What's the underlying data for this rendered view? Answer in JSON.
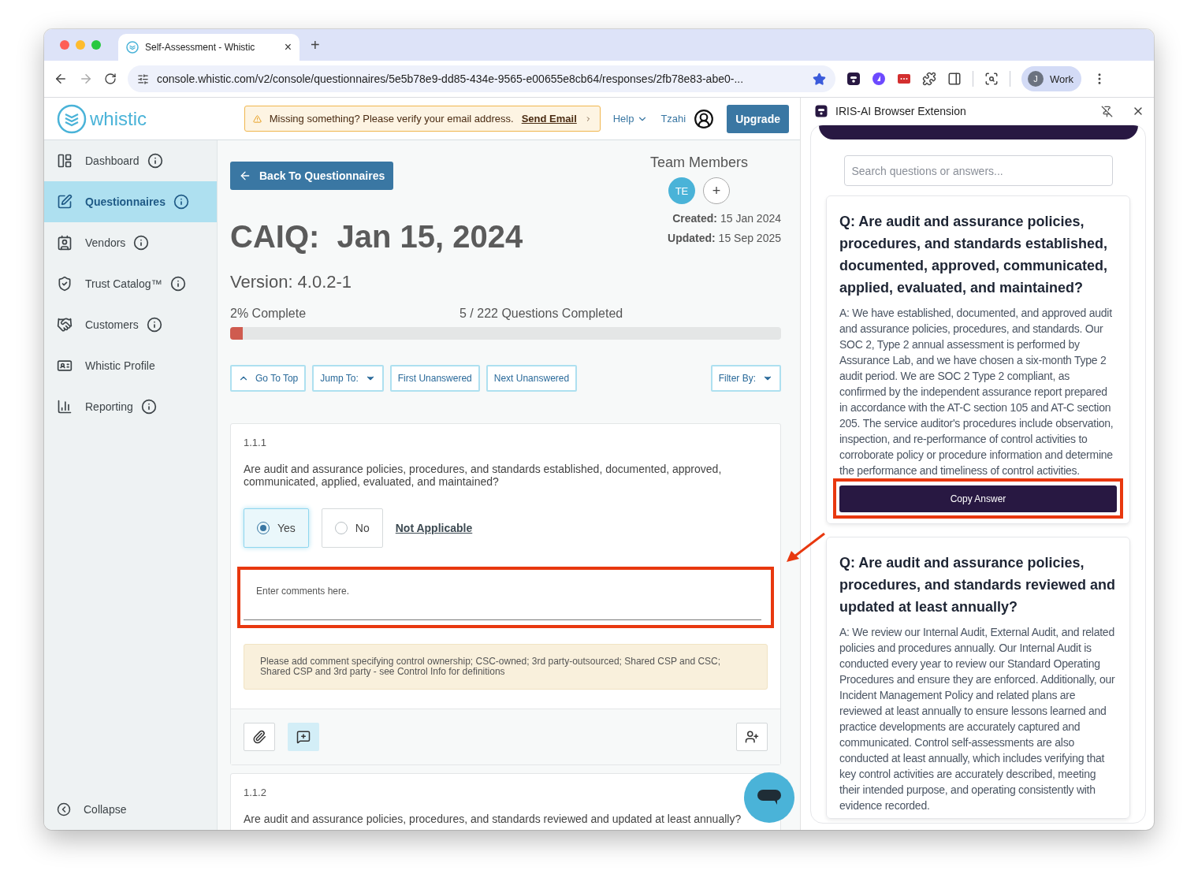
{
  "browser": {
    "tab": {
      "title": "Self-Assessment - Whistic",
      "close": "×"
    },
    "new_tab": "+",
    "url": "console.whistic.com/v2/console/questionnaires/5e5b78e9-dd85-434e-9565-e00655e8cb64/responses/2fb78e83-abe0-...",
    "profile": {
      "initial": "J",
      "name": "Work"
    }
  },
  "app": {
    "logo": "whistic",
    "banner": {
      "text": "Missing something? Please verify your email address.",
      "link": "Send Email"
    },
    "help": "Help",
    "user": "Tzahi",
    "upgrade": "Upgrade"
  },
  "sidebar": {
    "items": [
      {
        "label": "Dashboard",
        "info": true,
        "selected": false
      },
      {
        "label": "Questionnaires",
        "info": true,
        "selected": true
      },
      {
        "label": "Vendors",
        "info": true,
        "selected": false
      },
      {
        "label": "Trust Catalog™",
        "info": true,
        "selected": false
      },
      {
        "label": "Customers",
        "info": true,
        "selected": false
      },
      {
        "label": "Whistic Profile",
        "info": false,
        "selected": false
      },
      {
        "label": "Reporting",
        "info": true,
        "selected": false
      }
    ],
    "collapse": "Collapse"
  },
  "main": {
    "back": "Back To Questionnaires",
    "team": {
      "title": "Team Members",
      "members": [
        "TE"
      ],
      "add": "+"
    },
    "title": "CAIQ:  Jan 15, 2024",
    "created": {
      "label": "Created:",
      "value": "15 Jan 2024"
    },
    "updated": {
      "label": "Updated:",
      "value": "15 Sep 2025"
    },
    "version": "Version: 4.0.2-1",
    "progress": {
      "percent": "2% Complete",
      "count": "5 / 222 Questions Completed",
      "level": 0.023
    },
    "toolbar": [
      {
        "label": "Go To Top",
        "kind": "up"
      },
      {
        "label": "Jump To:",
        "kind": "dropdown"
      },
      {
        "label": "First Unanswered",
        "kind": "plain"
      },
      {
        "label": "Next Unanswered",
        "kind": "plain"
      }
    ],
    "filter": {
      "label": "Filter By:"
    },
    "questions": [
      {
        "number": "1.1.1",
        "text": "Are audit and assurance policies, procedures, and standards established, documented, approved, communicated, applied, evaluated, and maintained?",
        "options": [
          {
            "label": "Yes",
            "selected": true
          },
          {
            "label": "No",
            "selected": false
          }
        ],
        "not_applicable": "Not Applicable",
        "comment_placeholder": "Enter comments here.",
        "hint": "Please add comment specifying control ownership; CSC-owned; 3rd party-outsourced; Shared CSP and CSC; Shared CSP and 3rd party - see Control Info for definitions",
        "tools": [
          {
            "kind": "attach",
            "selected": false
          },
          {
            "kind": "comment",
            "selected": true
          }
        ]
      },
      {
        "number": "1.1.2",
        "text": "Are audit and assurance policies, procedures, and standards reviewed and updated at least annually?"
      }
    ]
  },
  "extension": {
    "title": "IRIS-AI Browser Extension",
    "search_placeholder": "Search questions or answers...",
    "cards": [
      {
        "question": "Q: Are audit and assurance policies, procedures, and standards established, documented, approved, communicated, applied, evaluated, and maintained?",
        "answer": "A: We have established, documented, and approved audit and assurance policies, procedures, and standards. Our SOC 2, Type 2 annual assessment is performed by Assurance Lab, and we have chosen a six-month Type 2 audit period. We are SOC 2 Type 2 compliant, as confirmed by the independent assurance report prepared in accordance with the AT-C section 105 and AT-C section 205. The service auditor's procedures include observation, inspection, and re-performance of control activities to corroborate policy or procedure information and determine the performance and timeliness of control activities.",
        "button": "Copy Answer"
      },
      {
        "question": "Q: Are audit and assurance policies, procedures, and standards reviewed and updated at least annually?",
        "answer": "A: We review our Internal Audit, External Audit, and related policies and procedures annually. Our Internal Audit is conducted every year to review our Standard Operating Procedures and ensure they are enforced. Additionally, our Incident Management Policy and related plans are reviewed at least annually to ensure lessons learned and practice developments are accurately captured and communicated. Control self-assessments are also conducted at least annually, which includes verifying that key control activities are accurately described, meeting their intended purpose, and operating consistently with evidence recorded."
      }
    ]
  }
}
